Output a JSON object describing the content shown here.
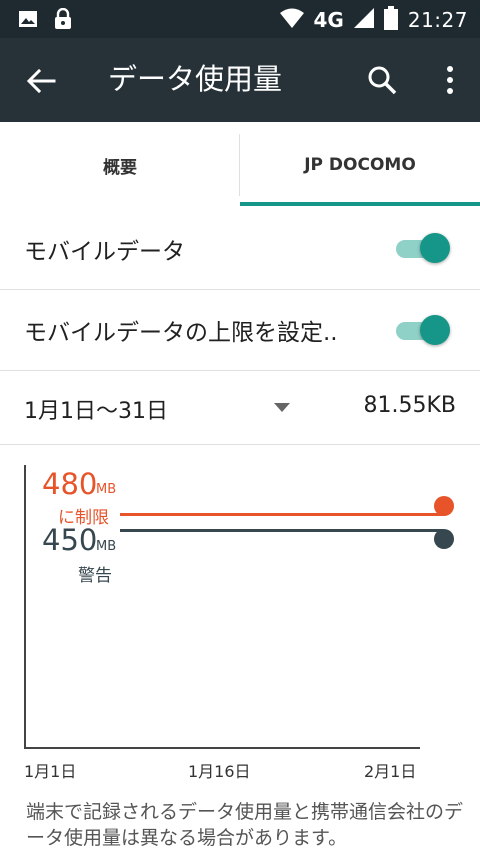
{
  "status_bar": {
    "network": "4G",
    "time": "21:27",
    "icons": [
      "image-icon",
      "lock-icon",
      "wifi-icon",
      "signal-icon",
      "battery-icon"
    ]
  },
  "app_bar": {
    "title": "データ使用量",
    "icons": [
      "back-arrow-icon",
      "search-icon",
      "more-vert-icon"
    ]
  },
  "tabs": [
    {
      "label": "概要",
      "selected": false
    },
    {
      "label": "JP DOCOMO",
      "selected": true
    }
  ],
  "settings": {
    "mobile_data": {
      "label": "モバイルデータ",
      "enabled": true
    },
    "mobile_data_limit": {
      "label": "モバイルデータの上限を設定..",
      "enabled": true
    }
  },
  "cycle": {
    "range": "1月1日〜31日",
    "total": "81.55KB"
  },
  "chart": {
    "limit": {
      "value": "480",
      "unit": "MB",
      "label": "に制限"
    },
    "warning": {
      "value": "450",
      "unit": "MB",
      "label": "警告"
    },
    "x_ticks": [
      "1月1日",
      "1月16日",
      "2月1日"
    ]
  },
  "footnote": "端末で記録されるデータ使用量と携帯通信会社のデータ使用量は異なる場合があります。",
  "colors": {
    "accent": "#159688",
    "limit": "#e8542a",
    "warning": "#37474f",
    "app_bar": "#263238"
  }
}
